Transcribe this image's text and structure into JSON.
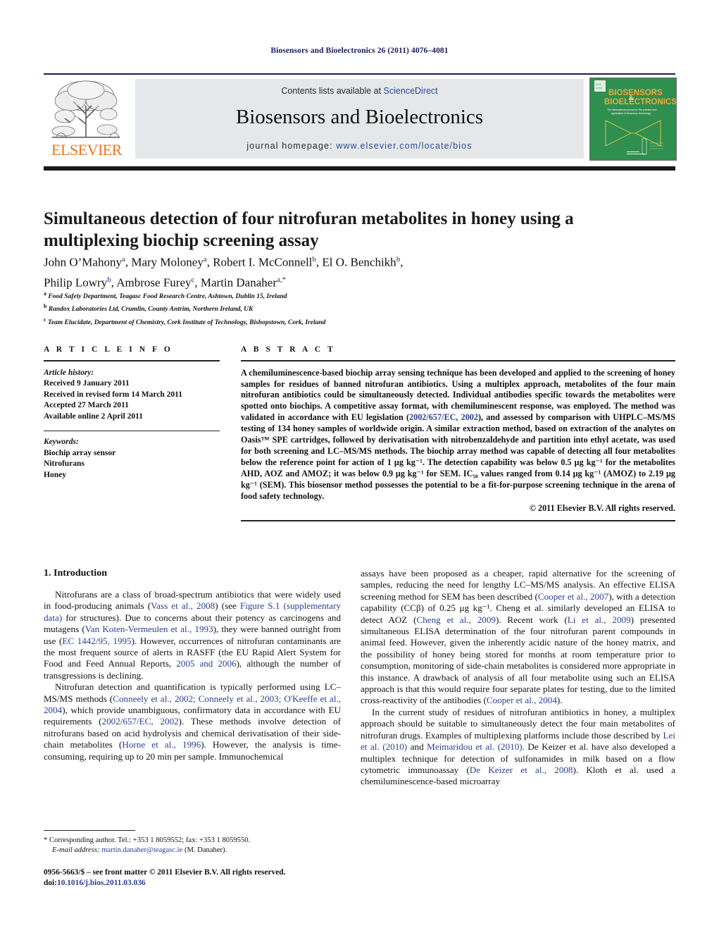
{
  "running_head": "Biosensors and Bioelectronics 26 (2011) 4076–4081",
  "masthead": {
    "contents_prefix": "Contents lists available at ",
    "sciencedirect": "ScienceDirect",
    "journal_name": "Biosensors and Bioelectronics",
    "homepage_label": "journal homepage: ",
    "homepage_url": "www.elsevier.com/locate/bios",
    "publisher_logo_text": "ELSEVIER",
    "cover_title_line1": "BIOSENSORS",
    "cover_title_amp": "&",
    "cover_title_line2": "BIOELECTRONICS",
    "cover_subtitle": "The international journal for the practice and application of biosensor technology",
    "brand_green": "#2f8f4e",
    "brand_orange": "#e87722",
    "link_blue": "#2a4b9b",
    "navy": "#1b1b5e"
  },
  "article": {
    "title": "Simultaneous detection of four nitrofuran metabolites in honey using a multiplexing biochip screening assay",
    "authors_line1_pre": "John O'Mahony",
    "authors": "John O'Mahony a, Mary Moloney a, Robert I. McConnell b, El O. Benchikh b, Philip Lowry b, Ambrose Furey c, Martin Danaher a,*",
    "affiliation_a": "Food Safety Department, Teagasc Food Research Centre, Ashtown, Dublin 15, Ireland",
    "affiliation_b": "Randox Laboratories Ltd, Crumlin, County Antrim, Northern Ireland, UK",
    "affiliation_c": "Team Elucidate, Department of Chemistry, Cork Institute of Technology, Bishopstown, Cork, Ireland"
  },
  "article_info": {
    "heading": "A R T I C L E   I N F O",
    "history_label": "Article history:",
    "history": [
      "Received 9 January 2011",
      "Received in revised form 14 March 2011",
      "Accepted 27 March 2011",
      "Available online 2 April 2011"
    ],
    "keywords_label": "Keywords:",
    "keywords": [
      "Biochip array sensor",
      "Nitrofurans",
      "Honey"
    ]
  },
  "abstract": {
    "heading": "A B S T R A C T",
    "copyright": "© 2011 Elsevier B.V. All rights reserved.",
    "paragraphs": [
      {
        "parts": [
          {
            "t": "A chemiluminescence-based biochip array sensing technique has been developed and applied to the screening of honey samples for residues of banned nitrofuran antibiotics. Using a multiplex approach, metabolites of the four main nitrofuran antibiotics could be simultaneously detected. Individual antibodies specific towards the metabolites were spotted onto biochips. A competitive assay format, with chemiluminescent response, was employed. The method was validated in accordance with EU legislation (",
            "ref": false
          },
          {
            "t": "2002/657/EC, 2002",
            "ref": true
          },
          {
            "t": "), and assessed by comparison with UHPLC–MS/MS testing of 134 honey samples of worldwide origin. A similar extraction method, based on extraction of the analytes on Oasis™ SPE cartridges, followed by derivatisation with nitrobenzaldehyde and partition into ethyl acetate, was used for both screening and LC–MS/MS methods. The biochip array method was capable of detecting all four metabolites below the reference point for action of 1 μg kg⁻¹. The detection capability was below 0.5 μg kg⁻¹ for the metabolites AHD, AOZ and AMOZ; it was below 0.9 μg kg⁻¹ for SEM. IC₅₀ values ranged from 0.14 μg kg⁻¹ (AMOZ) to 2.19 μg kg⁻¹ (SEM). This biosensor method possesses the potential to be a fit-for-purpose screening technique in the arena of food safety technology.",
            "ref": false
          }
        ]
      }
    ]
  },
  "body": {
    "section_number_title": "1.  Introduction",
    "left_paragraphs": [
      {
        "parts": [
          {
            "t": "Nitrofurans are a class of broad-spectrum antibiotics that were widely used in food-producing animals (",
            "ref": false
          },
          {
            "t": "Vass et al., 2008",
            "ref": true
          },
          {
            "t": ") (see ",
            "ref": false
          },
          {
            "t": "Figure S.1 (supplementary data)",
            "ref": true
          },
          {
            "t": " for structures). Due to concerns about their potency as carcinogens and mutagens (",
            "ref": false
          },
          {
            "t": "Van Koten-Vermeulen et al., 1993",
            "ref": true
          },
          {
            "t": "), they were banned outright from use (",
            "ref": false
          },
          {
            "t": "EC 1442/95, 1995",
            "ref": true
          },
          {
            "t": "). However, occurrences of nitrofuran contaminants are the most frequent source of alerts in RASFF (the EU Rapid Alert System for Food and Feed Annual Reports, ",
            "ref": false
          },
          {
            "t": "2005 and 2006",
            "ref": true
          },
          {
            "t": "), although the number of transgressions is declining.",
            "ref": false
          }
        ]
      },
      {
        "parts": [
          {
            "t": "Nitrofuran detection and quantification is typically performed using LC–MS/MS methods (",
            "ref": false
          },
          {
            "t": "Conneely et al., 2002; Conneely et al., 2003; O'Keeffe et al., 2004",
            "ref": true
          },
          {
            "t": "), which provide unambiguous, confirmatory data in accordance with EU requirements (",
            "ref": false
          },
          {
            "t": "2002/657/EC, 2002",
            "ref": true
          },
          {
            "t": "). These methods involve detection of nitrofurans based on acid hydrolysis and chemical derivatisation of their side-chain metabolites (",
            "ref": false
          },
          {
            "t": "Horne et al., 1996",
            "ref": true
          },
          {
            "t": "). However, the analysis is time-consuming, requiring up to 20 min per sample. Immunochemical",
            "ref": false
          }
        ]
      }
    ],
    "right_paragraphs": [
      {
        "indent": false,
        "parts": [
          {
            "t": "assays have been proposed as a cheaper, rapid alternative for the screening of samples, reducing the need for lengthy LC–MS/MS analysis. An effective ELISA screening method for SEM has been described (",
            "ref": false
          },
          {
            "t": "Cooper et al., 2007",
            "ref": true
          },
          {
            "t": "), with a detection capability (CCβ) of 0.25 μg kg⁻¹. Cheng et al. similarly developed an ELISA to detect AOZ (",
            "ref": false
          },
          {
            "t": "Cheng et al., 2009",
            "ref": true
          },
          {
            "t": "). Recent work (",
            "ref": false
          },
          {
            "t": "Li et al., 2009",
            "ref": true
          },
          {
            "t": ") presented simultaneous ELISA determination of the four nitrofuran parent compounds in animal feed. However, given the inherently acidic nature of the honey matrix, and the possibility of honey being stored for months at room temperature prior to consumption, monitoring of side-chain metabolites is considered more appropriate in this instance. A drawback of analysis of all four metabolite using such an ELISA approach is that this would require four separate plates for testing, due to the limited cross-reactivity of the antibodies (",
            "ref": false
          },
          {
            "t": "Cooper et al., 2004",
            "ref": true
          },
          {
            "t": ").",
            "ref": false
          }
        ]
      },
      {
        "indent": true,
        "parts": [
          {
            "t": "In the current study of residues of nitrofuran antibiotics in honey, a multiplex approach should be suitable to simultaneously detect the four main metabolites of nitrofuran drugs. Examples of multiplexing platforms include those described by ",
            "ref": false
          },
          {
            "t": "Lei et al. (2010)",
            "ref": true
          },
          {
            "t": " and ",
            "ref": false
          },
          {
            "t": "Meimaridou et al. (2010)",
            "ref": true
          },
          {
            "t": ". De Keizer et al. have also developed a multiplex technique for detection of sulfonamides in milk based on a flow cytometric immunoassay (",
            "ref": false
          },
          {
            "t": "De Keizer et al., 2008",
            "ref": true
          },
          {
            "t": "). Kloth et al. used a chemiluminescence-based microarray",
            "ref": false
          }
        ]
      }
    ]
  },
  "footer": {
    "corresponding_marker": "*",
    "corresponding_text": "Corresponding author. Tel.: +353 1 8059552; fax: +353 1 8059550.",
    "email_label": "E-mail address:",
    "email": "martin.danaher@teagasc.ie",
    "email_suffix": "(M. Danaher).",
    "imprint_line": "0956-5663/$ – see front matter © 2011 Elsevier B.V. All rights reserved.",
    "doi_label": "doi:",
    "doi": "10.1016/j.bios.2011.03.036"
  }
}
